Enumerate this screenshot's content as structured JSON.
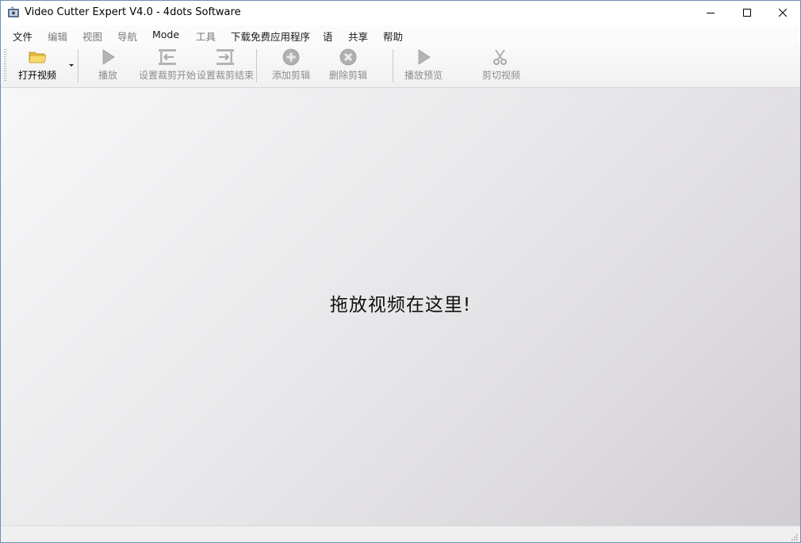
{
  "window": {
    "title": "Video Cutter Expert V4.0 - 4dots Software",
    "minimize_icon": "minimize-icon",
    "maximize_icon": "maximize-icon",
    "close_icon": "close-icon"
  },
  "menu": [
    {
      "label": "文件",
      "enabled": true
    },
    {
      "label": "编辑",
      "enabled": false
    },
    {
      "label": "视图",
      "enabled": false
    },
    {
      "label": "导航",
      "enabled": false
    },
    {
      "label": "Mode",
      "enabled": true
    },
    {
      "label": "工具",
      "enabled": false
    },
    {
      "label": "下载免费应用程序",
      "enabled": true
    },
    {
      "label": "语",
      "enabled": true
    },
    {
      "label": "共享",
      "enabled": true
    },
    {
      "label": "帮助",
      "enabled": true
    }
  ],
  "toolbar": {
    "open_video": "打开视频",
    "play": "播放",
    "set_cut_start": "设置裁剪开始",
    "set_cut_end": "设置裁剪结束",
    "add_clip": "添加剪辑",
    "delete_clip": "删除剪辑",
    "play_preview": "播放预览",
    "cut_video": "剪切视频"
  },
  "dropzone": {
    "message": "拖放视频在这里!"
  },
  "colors": {
    "window_border": "#6b8fb5",
    "disabled_text": "#8c8c8c",
    "folder_yellow": "#f2c94c",
    "icon_gray": "#a8a8a8"
  }
}
